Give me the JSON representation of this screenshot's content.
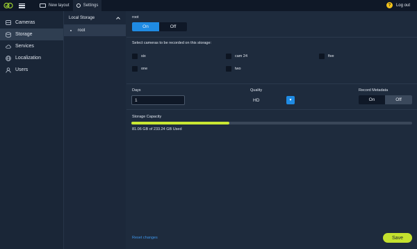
{
  "topbar": {
    "new_layout": "New layout",
    "settings": "Settings",
    "logout": "Log out",
    "help": "?"
  },
  "sidebar": {
    "items": [
      {
        "label": "Cameras",
        "icon": "camera-icon"
      },
      {
        "label": "Storage",
        "icon": "storage-icon"
      },
      {
        "label": "Services",
        "icon": "cloud-icon"
      },
      {
        "label": "Localization",
        "icon": "globe-icon"
      },
      {
        "label": "Users",
        "icon": "user-icon"
      }
    ],
    "active": "Storage"
  },
  "storage_list": {
    "header": "Local Storage",
    "items": [
      "root"
    ]
  },
  "main": {
    "storage_name": "root",
    "toggle": {
      "on": "On",
      "off": "Off",
      "selected": "On"
    },
    "cameras_label": "Select cameras to be recorded on this storage:",
    "cameras": [
      "six",
      "cam 24",
      "five",
      "one",
      "two"
    ],
    "days_label": "Days",
    "days_value": "1",
    "quality_label": "Quality",
    "quality_value": "HD",
    "metadata_label": "Record Metadata",
    "metadata_toggle": {
      "on": "On",
      "off": "Off",
      "selected": "Off"
    },
    "capacity_label": "Storage Capacity",
    "capacity_used_fraction": 0.35,
    "capacity_text": "81.06 GB of 233.24 GB Used",
    "reset": "Reset changes",
    "save": "Save"
  },
  "colors": {
    "accent_blue": "#1f8be3",
    "accent_green": "#c4e12e",
    "help_yellow": "#f2c21b"
  }
}
